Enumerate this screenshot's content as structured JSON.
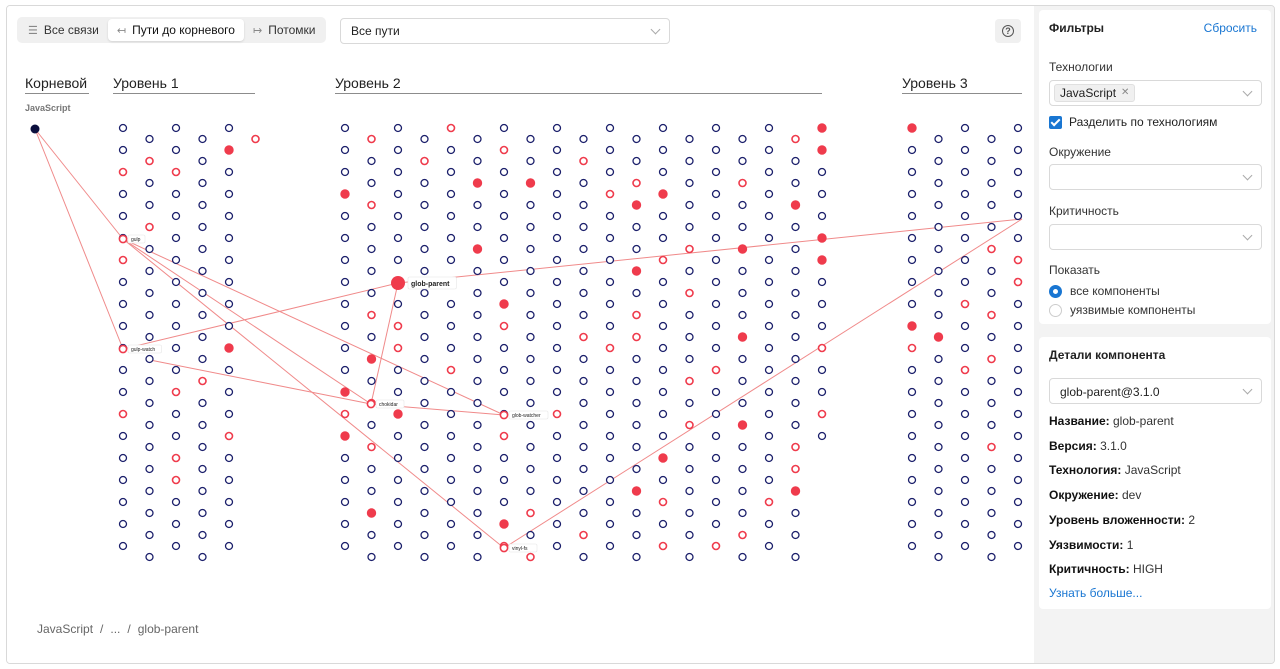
{
  "toolbar": {
    "tabs": [
      {
        "label": "Все связи",
        "icon": "list-icon",
        "active": false
      },
      {
        "label": "Пути до корневого",
        "icon": "arrow-left-bar-icon",
        "active": true
      },
      {
        "label": "Потомки",
        "icon": "arrow-right-bar-icon",
        "active": false
      }
    ],
    "paths_select": "Все пути"
  },
  "graph": {
    "root_label": "Корневой",
    "root_sublabel": "JavaScript",
    "levels": [
      "Уровень 1",
      "Уровень 2",
      "Уровень 3"
    ],
    "highlighted": {
      "main": "glob-parent",
      "nodes": [
        "gulp",
        "gulp-watch",
        "chokidar",
        "glob-watcher",
        "vinyl-fs"
      ]
    },
    "colors": {
      "normal": "#1b1f6b",
      "vulnerable": "#ef3b4c",
      "edge": "#f08a8a",
      "root": "#0b0f3d"
    }
  },
  "breadcrumb": [
    "JavaScript",
    "/",
    "...",
    "/",
    "glob-parent"
  ],
  "filters": {
    "title": "Фильтры",
    "reset": "Сбросить",
    "technologies_label": "Технологии",
    "technology_tag": "JavaScript",
    "split_label": "Разделить по технологиям",
    "environment_label": "Окружение",
    "criticality_label": "Критичность",
    "show_label": "Показать",
    "show_options": [
      "все компоненты",
      "уязвимые компоненты"
    ],
    "show_selected": 0
  },
  "details": {
    "title": "Детали компонента",
    "selected": "glob-parent@3.1.0",
    "rows": [
      {
        "key": "Название:",
        "value": "glob-parent"
      },
      {
        "key": "Версия:",
        "value": "3.1.0"
      },
      {
        "key": "Технология:",
        "value": "JavaScript"
      },
      {
        "key": "Окружение:",
        "value": "dev"
      },
      {
        "key": "Уровень вложенности:",
        "value": "2"
      },
      {
        "key": "Уязвимости:",
        "value": "1"
      },
      {
        "key": "Критичность:",
        "value": "HIGH"
      }
    ],
    "more_link": "Узнать больше..."
  }
}
